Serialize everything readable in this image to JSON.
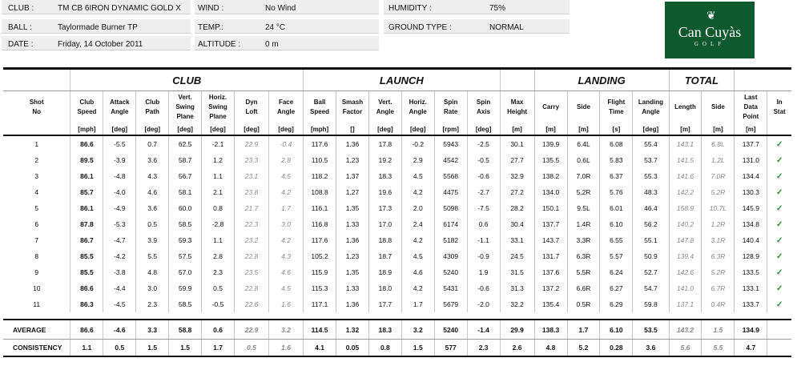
{
  "session": {
    "club_label": "CLUB :",
    "club_value": "TM CB 6IRON DYNAMIC GOLD X",
    "ball_label": "BALL :",
    "ball_value": "Taylormade Burner TP",
    "date_label": "DATE :",
    "date_value": "Friday, 14 October 2011",
    "wind_label": "WIND :",
    "wind_value": "No Wind",
    "temp_label": "TEMP.:",
    "temp_value": "24 °C",
    "altitude_label": "ALTITUDE :",
    "altitude_value": "0 m",
    "humidity_label": "HUMIDITY :",
    "humidity_value": "75%",
    "ground_label": "GROUND TYPE :",
    "ground_value": "NORMAL"
  },
  "logo": {
    "name": "Can Cuyàs",
    "sub": "GOLF",
    "brand_color": "#0e5a2e"
  },
  "groups": {
    "club": "CLUB",
    "launch": "LAUNCH",
    "landing": "LANDING",
    "total": "TOTAL"
  },
  "columns": [
    {
      "label": "Shot No",
      "unit": ""
    },
    {
      "label": "Club Speed",
      "unit": "[mph]"
    },
    {
      "label": "Attack Angle",
      "unit": "[deg]"
    },
    {
      "label": "Club Path",
      "unit": "[deg]"
    },
    {
      "label": "Vert. Swing Plane",
      "unit": "[deg]"
    },
    {
      "label": "Horiz. Swing Plane",
      "unit": "[deg]"
    },
    {
      "label": "Dyn Loft",
      "unit": "[deg]"
    },
    {
      "label": "Face Angle",
      "unit": "[deg]"
    },
    {
      "label": "Ball Speed",
      "unit": "[mph]"
    },
    {
      "label": "Smash Factor",
      "unit": "[]"
    },
    {
      "label": "Vert. Angle",
      "unit": "[deg]"
    },
    {
      "label": "Horiz. Angle",
      "unit": "[deg]"
    },
    {
      "label": "Spin Rate",
      "unit": "[rpm]"
    },
    {
      "label": "Spin Axis",
      "unit": "[deg]"
    },
    {
      "label": "Max Height",
      "unit": "[m]"
    },
    {
      "label": "Carry",
      "unit": "[m]"
    },
    {
      "label": "Side",
      "unit": "[m]"
    },
    {
      "label": "Flight Time",
      "unit": "[s]"
    },
    {
      "label": "Landing Angle",
      "unit": "[deg]"
    },
    {
      "label": "Length",
      "unit": "[m]"
    },
    {
      "label": "Side",
      "unit": "[m]"
    },
    {
      "label": "Last Data Point",
      "unit": "[m]"
    },
    {
      "label": "In Stat",
      "unit": ""
    }
  ],
  "rows": [
    [
      "1",
      "86.6",
      "-5.5",
      "0.7",
      "62.5",
      "-2.1",
      "22.9",
      "-0.4",
      "117.6",
      "1.36",
      "17.8",
      "-0.2",
      "5943",
      "-2.5",
      "30.1",
      "139.9",
      "6.4L",
      "6.08",
      "55.4",
      "143.1",
      "6.8L",
      "137.7",
      "✓"
    ],
    [
      "2",
      "89.5",
      "-3.9",
      "3.6",
      "58.7",
      "1.2",
      "23.3",
      "2.8",
      "110.5",
      "1.23",
      "19.2",
      "2.9",
      "4542",
      "-0.5",
      "27.7",
      "135.5",
      "0.6L",
      "5.83",
      "53.7",
      "141.5",
      "1.2L",
      "131.0",
      "✓"
    ],
    [
      "3",
      "86.1",
      "-4.8",
      "4.3",
      "56.7",
      "1.1",
      "23.1",
      "4.5",
      "118.2",
      "1.37",
      "18.3",
      "4.5",
      "5568",
      "-0.6",
      "32.9",
      "138.2",
      "7.0R",
      "6.37",
      "55.3",
      "141.6",
      "7.0R",
      "134.4",
      "✓"
    ],
    [
      "4",
      "85.7",
      "-4.0",
      "4.6",
      "58.1",
      "2.1",
      "23.8",
      "4.2",
      "108.8",
      "1.27",
      "19.6",
      "4.2",
      "4475",
      "-2.7",
      "27.2",
      "134.0",
      "5.2R",
      "5.76",
      "48.3",
      "142.2",
      "5.2R",
      "130.3",
      "✓"
    ],
    [
      "5",
      "86.1",
      "-4.9",
      "3.6",
      "60.0",
      "0.8",
      "21.7",
      "1.7",
      "116.1",
      "1.35",
      "17.3",
      "2.0",
      "5098",
      "-7.5",
      "28.2",
      "150.1",
      "9.5L",
      "6.01",
      "46.4",
      "158.9",
      "10.7L",
      "145.9",
      "✓"
    ],
    [
      "6",
      "87.8",
      "-5.3",
      "0.5",
      "58.5",
      "-2.8",
      "22.3",
      "3.0",
      "116.8",
      "1.33",
      "17.0",
      "2.4",
      "6174",
      "0.6",
      "30.4",
      "137.7",
      "1.4R",
      "6.10",
      "56.2",
      "140.2",
      "1.2R",
      "134.8",
      "✓"
    ],
    [
      "7",
      "86.7",
      "-4.7",
      "3.9",
      "59.3",
      "1.1",
      "23.2",
      "4.2",
      "117.6",
      "1.36",
      "18.8",
      "4.2",
      "5182",
      "-1.1",
      "33.1",
      "143.7",
      "3.3R",
      "6.55",
      "55.1",
      "147.8",
      "3.1R",
      "140.4",
      "✓"
    ],
    [
      "8",
      "85.5",
      "-4.2",
      "5.5",
      "57.5",
      "2.8",
      "22.8",
      "4.3",
      "105.2",
      "1.23",
      "18.7",
      "4.5",
      "4309",
      "-0.9",
      "24.5",
      "131.7",
      "6.3R",
      "5.57",
      "50.9",
      "139.4",
      "6.3R",
      "128.9",
      "✓"
    ],
    [
      "9",
      "85.5",
      "-3.8",
      "4.8",
      "57.0",
      "2.3",
      "23.5",
      "4.6",
      "115.9",
      "1.35",
      "18.9",
      "4.6",
      "5240",
      "1.9",
      "31.5",
      "137.6",
      "5.5R",
      "6.24",
      "52.7",
      "142.6",
      "5.2R",
      "133.5",
      "✓"
    ],
    [
      "10",
      "86.6",
      "-4.4",
      "3.0",
      "59.9",
      "0.5",
      "22.8",
      "4.5",
      "115.3",
      "1.33",
      "18.0",
      "4.2",
      "5431",
      "-0.6",
      "31.3",
      "137.2",
      "6.6R",
      "6.27",
      "54.7",
      "141.0",
      "6.7R",
      "133.1",
      "✓"
    ],
    [
      "11",
      "86.3",
      "-4.5",
      "2.3",
      "58.5",
      "-0.5",
      "22.6",
      "1.6",
      "117.1",
      "1.36",
      "17.7",
      "1.7",
      "5679",
      "-2.0",
      "32.2",
      "135.4",
      "0.5R",
      "6.29",
      "59.8",
      "137.1",
      "0.4R",
      "133.7",
      "✓"
    ]
  ],
  "average": [
    "AVERAGE",
    "86.6",
    "-4.6",
    "3.3",
    "58.8",
    "0.6",
    "22.9",
    "3.2",
    "114.5",
    "1.32",
    "18.3",
    "3.2",
    "5240",
    "-1.4",
    "29.9",
    "138.3",
    "1.7",
    "6.10",
    "53.5",
    "143.2",
    "1.5",
    "134.9",
    ""
  ],
  "consistency": [
    "CONSISTENCY",
    "1.1",
    "0.5",
    "1.5",
    "1.5",
    "1.7",
    "0.5",
    "1.6",
    "4.1",
    "0.05",
    "0.8",
    "1.5",
    "577",
    "2.3",
    "2.6",
    "4.8",
    "5.2",
    "0.28",
    "3.6",
    "5.6",
    "5.5",
    "4.7",
    ""
  ]
}
